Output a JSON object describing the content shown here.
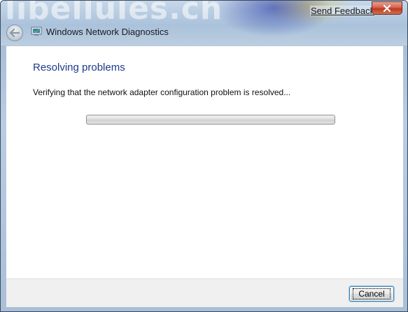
{
  "window": {
    "title": "Windows Network Diagnostics",
    "background_watermark": "libellules.ch",
    "send_feedback_label": "Send Feedback"
  },
  "main": {
    "heading": "Resolving problems",
    "status": "Verifying that the network adapter configuration problem is resolved...",
    "progress_value": 0
  },
  "footer": {
    "cancel_label": "Cancel"
  },
  "colors": {
    "heading": "#1e3a8a",
    "close_button": "#c0391f",
    "content_background": "#ffffff",
    "footer_background": "#f0f0f0"
  },
  "icons": {
    "close": "close-icon",
    "back": "back-arrow-icon",
    "app": "network-diagnostics-icon"
  }
}
